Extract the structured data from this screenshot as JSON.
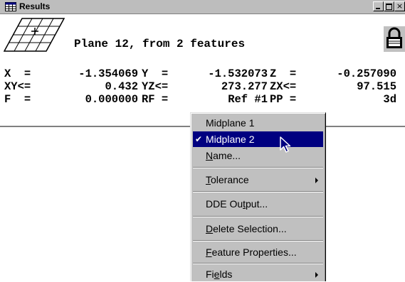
{
  "window": {
    "title": "Results",
    "feature_title": "Plane 12, from 2 features"
  },
  "results": {
    "rows": [
      [
        {
          "label": "X  =",
          "value": "-1.354069"
        },
        {
          "label": "Y  =",
          "value": "-1.532073"
        },
        {
          "label": "Z  =",
          "value": "-0.257090"
        }
      ],
      [
        {
          "label": "XY<=",
          "value": "0.432"
        },
        {
          "label": "YZ<=",
          "value": "273.277"
        },
        {
          "label": "ZX<=",
          "value": "97.515"
        }
      ],
      [
        {
          "label": "F  =",
          "value": "0.000000"
        },
        {
          "label": "RF =",
          "value": "Ref #1"
        },
        {
          "label": "PP =",
          "value": "3d"
        }
      ]
    ]
  },
  "context_menu": {
    "items": [
      {
        "pre": "",
        "u": "",
        "post": "Midplane 1",
        "checked": false,
        "selected": false,
        "submenu": false
      },
      {
        "pre": "",
        "u": "",
        "post": "Midplane 2",
        "checked": true,
        "selected": true,
        "submenu": false
      },
      {
        "pre": "",
        "u": "N",
        "post": "ame...",
        "checked": false,
        "selected": false,
        "submenu": false
      },
      {
        "pre": "",
        "u": "T",
        "post": "olerance",
        "checked": false,
        "selected": false,
        "submenu": true
      },
      {
        "pre": "DDE Ou",
        "u": "t",
        "post": "put...",
        "checked": false,
        "selected": false,
        "submenu": false
      },
      {
        "pre": "",
        "u": "D",
        "post": "elete Selection...",
        "checked": false,
        "selected": false,
        "submenu": false
      },
      {
        "pre": "",
        "u": "F",
        "post": "eature Properties...",
        "checked": false,
        "selected": false,
        "submenu": false
      },
      {
        "pre": "Fi",
        "u": "e",
        "post": "lds",
        "checked": false,
        "selected": false,
        "submenu": true
      }
    ],
    "check_glyph": "✔"
  },
  "icons": {
    "title": "table-icon",
    "plane": "plane-icon",
    "lock": "lock-icon",
    "cursor": "arrow-cursor-icon"
  },
  "colors": {
    "titlebar": "#bdbdbd",
    "menu_bg": "#c0c0c0",
    "selection": "#000080"
  }
}
